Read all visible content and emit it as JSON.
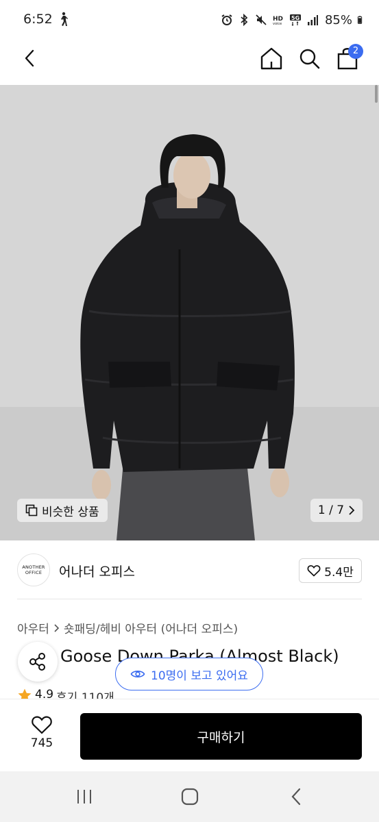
{
  "status_bar": {
    "time": "6:52",
    "battery": "85%",
    "icons": [
      "walk-icon",
      "alarm-icon",
      "bluetooth-icon",
      "mute-icon",
      "hd-voice-icon",
      "5g-icon",
      "signal-icon",
      "battery-icon"
    ]
  },
  "nav": {
    "back_icon": "chevron-left-icon",
    "home_icon": "home-icon",
    "search_icon": "search-icon",
    "cart_icon": "bag-icon",
    "cart_count": "2"
  },
  "gallery": {
    "similar_label": "비슷한 상품",
    "page_current": "1",
    "page_total": "7",
    "page_text": "1 / 7"
  },
  "brand": {
    "logo_line1": "ANOTHER",
    "logo_line2": "OFFICE",
    "name": "어나더 오피스",
    "likes": "5.4만"
  },
  "product": {
    "breadcrumb": [
      "아우터",
      "숏패딩/헤비 아우터 (어나더 오피스)"
    ],
    "title": "Goose Down Parka (Almost Black)",
    "rating": "4.9",
    "reviews": "후기 110개",
    "viewers": "10명이 보고 있어요"
  },
  "action_bar": {
    "wish_count": "745",
    "buy_label": "구매하기"
  },
  "colors": {
    "accent": "#3b6cf0",
    "buy_button": "#000000",
    "star": "#f5a623"
  }
}
